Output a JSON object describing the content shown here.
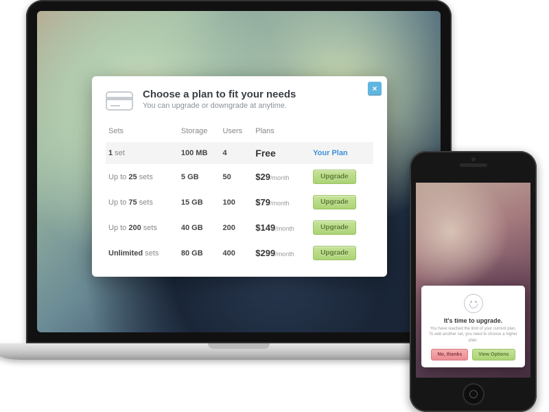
{
  "modal": {
    "title": "Choose a plan to fit your needs",
    "subtitle": "You can upgrade or downgrade at anytime.",
    "close_glyph": "×",
    "columns": {
      "c1": "Sets",
      "c2": "Storage",
      "c3": "Users",
      "c4": "Plans"
    },
    "current_plan_label": "Your Plan",
    "upgrade_label": "Upgrade",
    "rows": [
      {
        "sets_pre": "",
        "sets_b": "1",
        "sets_post": " set",
        "storage": "100 MB",
        "users": "4",
        "price": "Free",
        "per": "",
        "current": true
      },
      {
        "sets_pre": "Up to ",
        "sets_b": "25",
        "sets_post": " sets",
        "storage": "5 GB",
        "users": "50",
        "price": "$29",
        "per": "/month",
        "current": false
      },
      {
        "sets_pre": "Up to ",
        "sets_b": "75",
        "sets_post": " sets",
        "storage": "15 GB",
        "users": "100",
        "price": "$79",
        "per": "/month",
        "current": false
      },
      {
        "sets_pre": "Up to ",
        "sets_b": "200",
        "sets_post": " sets",
        "storage": "40 GB",
        "users": "200",
        "price": "$149",
        "per": "/month",
        "current": false
      },
      {
        "sets_pre": "",
        "sets_b": "Unlimited",
        "sets_post": " sets",
        "storage": "80 GB",
        "users": "400",
        "price": "$299",
        "per": "/month",
        "current": false
      }
    ]
  },
  "phone_modal": {
    "title": "It's time to upgrade.",
    "body_line1": "You have reached the limit of your current plan.",
    "body_line2": "To add another set, you need to choose a higher plan.",
    "no_label": "No, thanks",
    "yes_label": "View Options"
  }
}
